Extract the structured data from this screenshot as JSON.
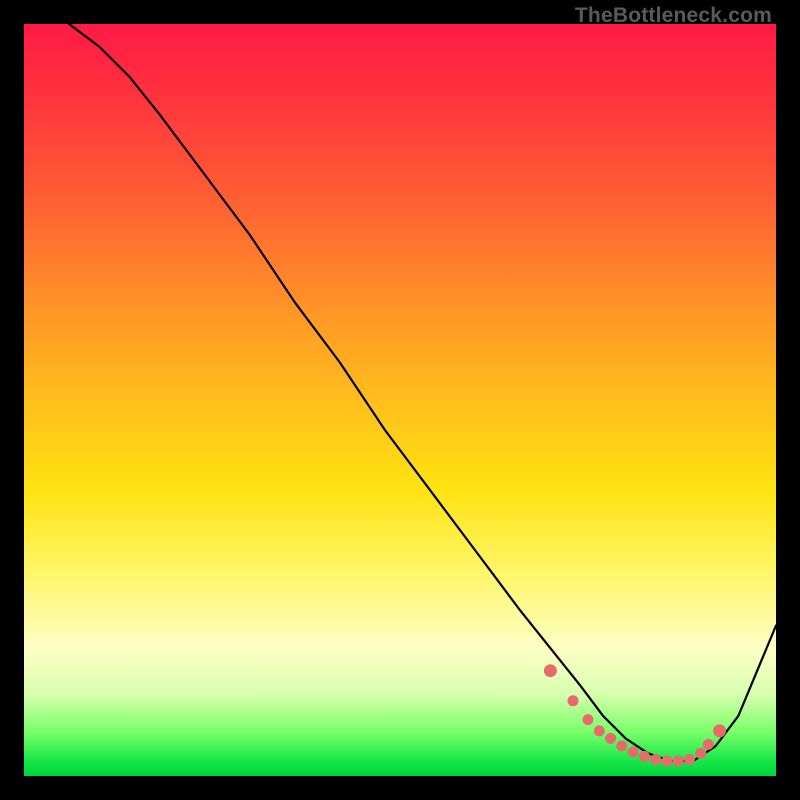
{
  "watermark": "TheBottleneck.com",
  "colors": {
    "curve": "#000000",
    "dots": "#e86a6a",
    "gradient_stops": [
      "#ff1a45",
      "#ff5a35",
      "#ffb81e",
      "#fff66a",
      "#d9ffb0",
      "#17e84a",
      "#00d43a"
    ]
  },
  "chart_data": {
    "type": "line",
    "title": "",
    "xlabel": "",
    "ylabel": "",
    "xlim": [
      0,
      100
    ],
    "ylim": [
      0,
      100
    ],
    "grid": false,
    "legend": false,
    "series": [
      {
        "name": "bottleneck-curve",
        "x": [
          6,
          10,
          14,
          18,
          24,
          30,
          36,
          42,
          48,
          54,
          60,
          66,
          70,
          74,
          77,
          80,
          83,
          86,
          89,
          92,
          95,
          100
        ],
        "y": [
          100,
          97,
          93,
          88,
          80,
          72,
          63,
          55,
          46,
          38,
          30,
          22,
          17,
          12,
          8,
          5,
          3,
          2,
          2,
          4,
          8,
          20
        ]
      }
    ],
    "highlight_points": {
      "name": "flat-region-dots",
      "x": [
        70,
        73,
        75,
        76.5,
        78,
        79.5,
        81,
        82.5,
        84,
        85.5,
        87,
        88.5,
        90,
        91,
        92.5
      ],
      "y": [
        14,
        10,
        7.5,
        6,
        5,
        4,
        3.2,
        2.6,
        2.2,
        2,
        2,
        2.2,
        3,
        4.2,
        6
      ]
    }
  }
}
